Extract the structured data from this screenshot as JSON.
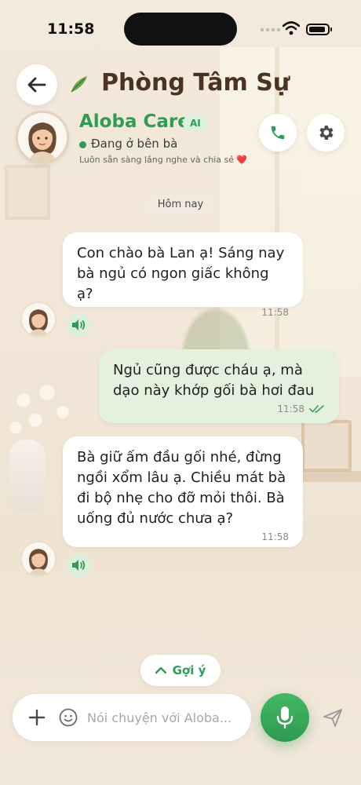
{
  "status_bar": {
    "time": "11:58"
  },
  "header": {
    "title": "Phòng Tâm Sự",
    "leaf_icon": "leaf-icon",
    "back_icon": "arrow-left-icon",
    "call_icon": "phone-icon",
    "settings_icon": "gear-icon"
  },
  "profile": {
    "name": "Aloba Care",
    "badge": "AI",
    "status": "Đang ở bên bà",
    "tagline": "Luôn sẵn sàng lắng nghe và chia sẻ",
    "tagline_icon": "❤️"
  },
  "date_chip": "Hôm nay",
  "messages": [
    {
      "side": "in",
      "text": "Con chào bà Lan ạ! Sáng nay bà ngủ có ngon giấc không ạ?",
      "time": "11:58"
    },
    {
      "side": "out",
      "text": "Ngủ cũng được cháu ạ, mà dạo này khớp gối bà hơi đau",
      "time": "11:58",
      "status": "read"
    },
    {
      "side": "in",
      "text": "Bà giữ ấm đầu gối nhé, đừng ngồi xổm lâu ạ. Chiều mát bà đi bộ nhẹ cho đỡ mỏi thôi. Bà uống đủ nước chưa ạ?",
      "time": "11:58"
    }
  ],
  "suggest": {
    "label": "Gợi ý",
    "icon": "chevron-up-icon"
  },
  "composer": {
    "placeholder": "Nói chuyện với Aloba...",
    "value": "",
    "plus_icon": "plus-icon",
    "emoji_icon": "smiley-icon",
    "mic_icon": "microphone-icon",
    "send_icon": "send-icon"
  },
  "colors": {
    "accent_green": "#2f9c53",
    "title_brown": "#4a3320",
    "outgoing_bubble": "#e4f1de",
    "incoming_bubble": "#ffffff"
  }
}
